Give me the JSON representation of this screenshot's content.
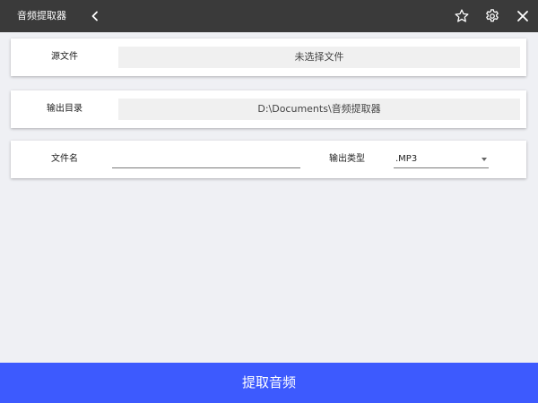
{
  "app": {
    "title": "音频提取器"
  },
  "titlebar": {
    "icons": [
      "chevron-left-icon",
      "star-icon",
      "gear-icon",
      "close-icon"
    ]
  },
  "source": {
    "label": "源文件",
    "value": "未选择文件"
  },
  "output_dir": {
    "label": "输出目录",
    "value": "D:\\Documents\\音频提取器"
  },
  "file": {
    "name_label": "文件名",
    "name_value": "",
    "type_label": "输出类型",
    "type_value": ".MP3"
  },
  "action": {
    "label": "提取音频"
  },
  "colors": {
    "titlebar_bg": "#3a3a3a",
    "page_bg": "#eff0f4",
    "accent": "#3d5afe"
  }
}
